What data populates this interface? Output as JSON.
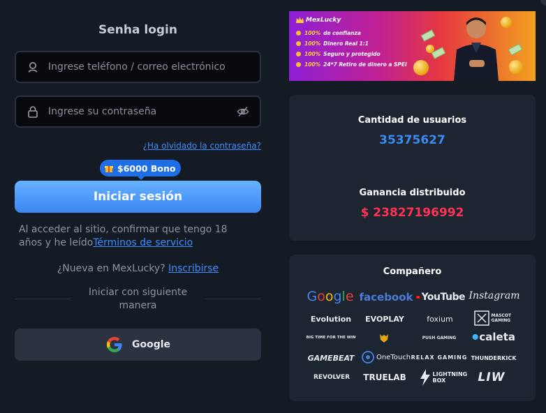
{
  "login": {
    "title": "Senha login",
    "phone_placeholder": "Ingrese teléfono / correo electrónico",
    "password_placeholder": "Ingrese su contraseña",
    "forgot_link": "¿Ha olvidado la contraseña?",
    "bonus_badge": "$6000 Bono",
    "submit_label": "Iniciar sesión",
    "terms_text": "Al acceder al sitio, confirmar que tengo 18 años y he leído",
    "terms_link": "Términos de servicio",
    "signup_text": "¿Nueva en MexLucky?",
    "signup_link": "Inscribirse",
    "alt_login_text": "Iniciar con siguiente manera",
    "google_label": "Google"
  },
  "banner": {
    "brand": "MexLucky",
    "items": [
      {
        "pct": "100%",
        "text": "de confianza"
      },
      {
        "pct": "100%",
        "text": "Dinero Real 1:1"
      },
      {
        "pct": "100%",
        "text": "Seguro y protegido"
      },
      {
        "pct": "100%",
        "text": "24*7 Retiro de dinero a SPEI"
      }
    ]
  },
  "stats": {
    "users_label": "Cantidad de usuarios",
    "users_value": "35375627",
    "users_color": "#3d8bf2",
    "winnings_label": "Ganancia distribuido",
    "winnings_value": "$ 23827196992",
    "winnings_color": "#ff3355"
  },
  "partners": {
    "title": "Compañero",
    "logos": {
      "google": "Google",
      "facebook": "facebook",
      "youtube": "YouTube",
      "instagram": "Instagram",
      "evolution": "Evolution",
      "evoplay": "EVOPLAY",
      "foxium": "foxium",
      "mascot": "MASCOT GAMING",
      "bftw": "BIG TIME FOR THE WIN",
      "push": "PUSH GAMING",
      "caleta": "caleta",
      "gamebeat": "GAMEBEAT",
      "onetouch": "OneTouch",
      "relax": "RELAX GAMING",
      "thunderkick": "THUNDERKICK",
      "revolver": "REVOLVER",
      "truelab": "TRUELAB",
      "lightning": "LIGHTNING BOX",
      "liw": "LIW"
    }
  }
}
